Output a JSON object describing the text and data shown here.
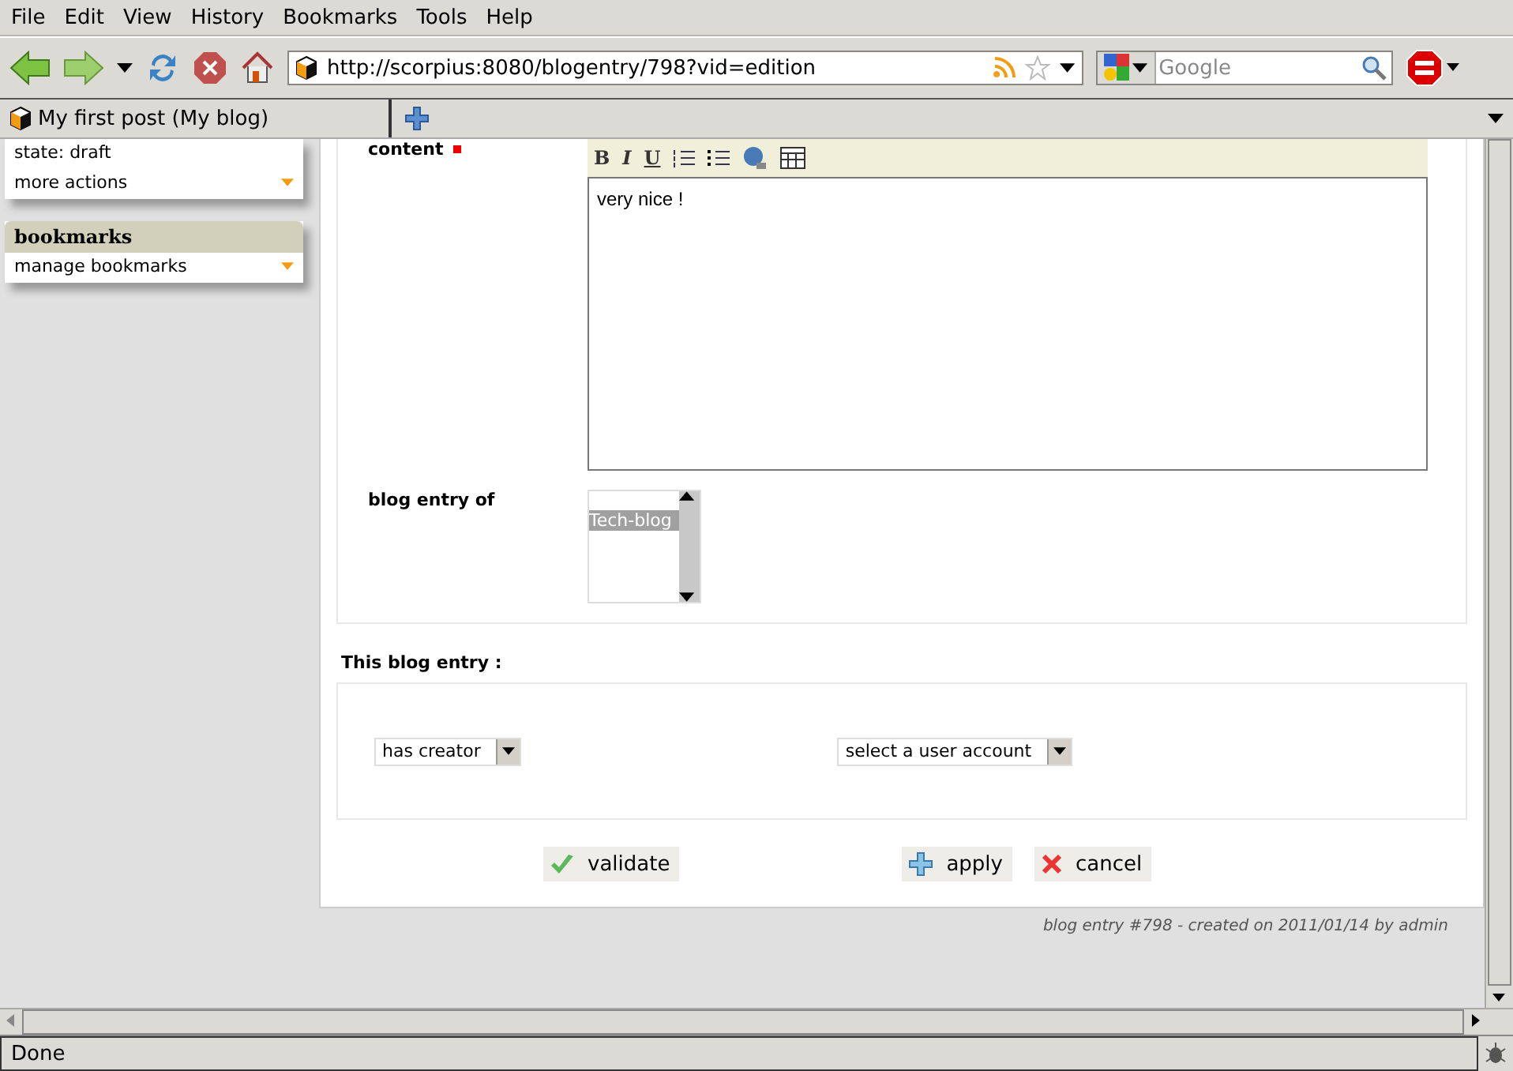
{
  "menu": [
    "File",
    "Edit",
    "View",
    "History",
    "Bookmarks",
    "Tools",
    "Help"
  ],
  "toolbar": {
    "url": "http://scorpius:8080/blogentry/798?vid=edition",
    "search_placeholder": "Google"
  },
  "tabs": [
    {
      "label": "My first post (My blog)",
      "selected": true
    }
  ],
  "sidebar": {
    "actions": [
      "state: draft",
      "more actions"
    ],
    "bookmarks": {
      "title": "bookmarks",
      "items": [
        "manage bookmarks"
      ]
    }
  },
  "form": {
    "content": {
      "label": "content",
      "required": true,
      "editor_buttons": [
        "B",
        "I",
        "U"
      ],
      "value": "very nice !"
    },
    "blog_entry_of": {
      "label": "blog entry of",
      "options": [
        {
          "label": "Tech-blog",
          "selected": true
        }
      ]
    }
  },
  "relations": {
    "title": "This blog entry :",
    "selects": [
      "has creator",
      "select a user account"
    ]
  },
  "buttons": [
    {
      "label": "validate",
      "kind": "validate"
    },
    {
      "label": "apply",
      "kind": "apply"
    },
    {
      "label": "cancel",
      "kind": "cancel"
    }
  ],
  "footer": "blog entry #798 - created on 2011/01/14 by admin",
  "status_bar": "Done"
}
